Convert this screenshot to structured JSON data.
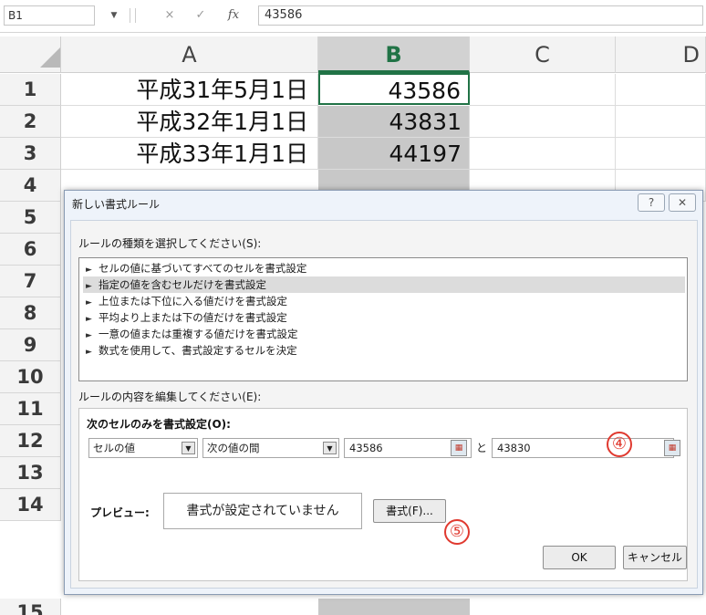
{
  "formula_bar": {
    "name_box": "B1",
    "cancel_icon": "×",
    "enter_icon": "✓",
    "fx_icon": "fx",
    "value": "43586"
  },
  "columns": [
    "A",
    "B",
    "C",
    "D"
  ],
  "rows": [
    {
      "num": "1",
      "a": "平成31年5月1日",
      "b": "43586"
    },
    {
      "num": "2",
      "a": "平成32年1月1日",
      "b": "43831"
    },
    {
      "num": "3",
      "a": "平成33年1月1日",
      "b": "44197"
    },
    {
      "num": "4"
    },
    {
      "num": "5"
    },
    {
      "num": "6"
    },
    {
      "num": "7"
    },
    {
      "num": "8"
    },
    {
      "num": "9"
    },
    {
      "num": "10"
    },
    {
      "num": "11"
    },
    {
      "num": "12"
    },
    {
      "num": "13"
    },
    {
      "num": "14"
    }
  ],
  "dialog": {
    "title": "新しい書式ルール",
    "help_button": "?",
    "close_button": "✕",
    "rule_type_label": "ルールの種類を選択してください(S):",
    "rule_types": [
      "セルの値に基づいてすべてのセルを書式設定",
      "指定の値を含むセルだけを書式設定",
      "上位または下位に入る値だけを書式設定",
      "平均より上または下の値だけを書式設定",
      "一意の値または重複する値だけを書式設定",
      "数式を使用して、書式設定するセルを決定"
    ],
    "selected_rule_index": 1,
    "edit_label": "ルールの内容を編集してください(E):",
    "panel_heading": "次のセルのみを書式設定(O):",
    "condition_type": "セルの値",
    "operator": "次の値の間",
    "value1": "43586",
    "and_label": "と",
    "value2": "43830",
    "preview_label": "プレビュー:",
    "preview_text": "書式が設定されていません",
    "format_button": "書式(F)...",
    "ok_button": "OK",
    "cancel_button": "キャンセル"
  },
  "callouts": {
    "four": "④",
    "five": "⑤"
  },
  "colors": {
    "excel_green": "#217346",
    "callout_red": "#e0392f",
    "selection_gray": "#c8c8c8"
  }
}
